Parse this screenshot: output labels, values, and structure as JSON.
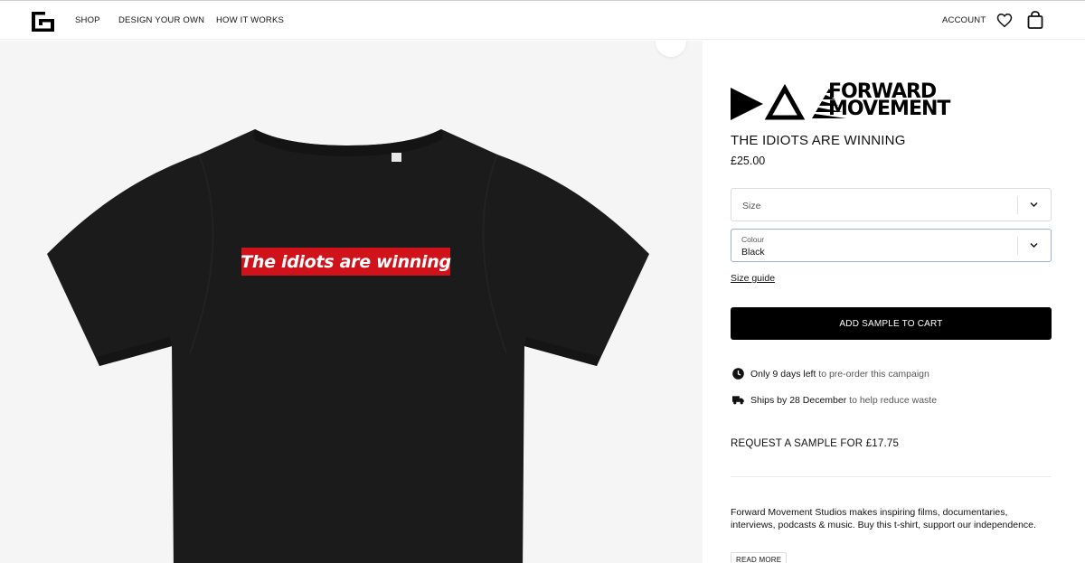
{
  "nav": {
    "shop": "SHOP",
    "design_your_own": "DESIGN YOUR OWN",
    "how_it_works": "HOW IT WORKS",
    "account": "ACCOUNT"
  },
  "icons": {
    "logo": "store-logo-icon",
    "wishlist": "heart-icon",
    "cart": "shopping-bag-icon",
    "zoom": "zoom-icon",
    "clock": "clock-icon",
    "truck": "truck-icon",
    "chevron": "chevron-down-icon"
  },
  "product_image": {
    "print_text": "The idiots are winning",
    "shirt_color": "#1a1a1a",
    "print_bg": "#d0121a"
  },
  "brand": {
    "line1": "FORWARD",
    "line2": "MOVEMENT"
  },
  "product": {
    "title": "THE IDIOTS ARE WINNING",
    "price": "£25.00"
  },
  "options": {
    "size_label": "Size",
    "colour_label": "Colour",
    "colour_value": "Black"
  },
  "size_guide": "Size guide",
  "add_to_cart": "ADD SAMPLE TO CART",
  "info": {
    "preorder_bold": "Only 9 days left",
    "preorder_rest": " to pre-order this campaign",
    "ships_bold": "Ships by 28 December",
    "ships_rest": " to help reduce waste"
  },
  "request_sample": "REQUEST A SAMPLE FOR £17.75",
  "description": "Forward Movement Studios makes inspiring films, documentaries, interviews, podcasts & music. Buy this t-shirt, support our independence.",
  "read_more": "READ MORE",
  "colors": {
    "accent": "#000000",
    "panel_bg": "#ffffff",
    "image_bg": "#f5f5f6"
  }
}
